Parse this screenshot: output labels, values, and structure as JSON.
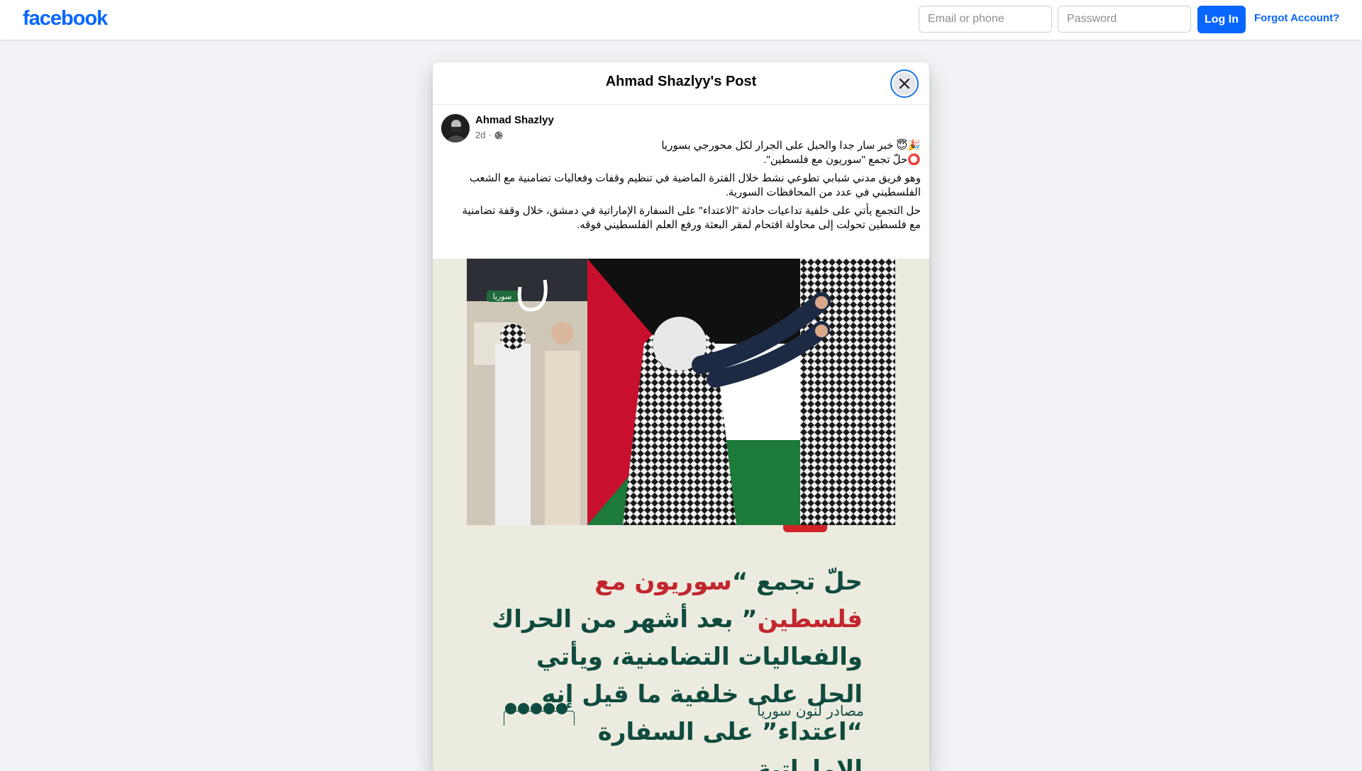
{
  "topbar": {
    "logo": "facebook",
    "email_placeholder": "Email or phone",
    "password_placeholder": "Password",
    "login_label": "Log In",
    "forgot_label": "Forgot Account?"
  },
  "modal": {
    "title": "Ahmad Shazlyy's Post"
  },
  "post": {
    "author": "Ahmad Shazlyy",
    "time": "2d",
    "separator": "·",
    "lines": [
      "🎉😇 خبر سار جدا والحبل على الجرار لكل محورجي بسوريا",
      "⭕حلّ تجمع \"سوريون مع فلسطين\".",
      "وهو فريق مدني شبابي تطوعي نشط خلال الفترة الماضية في تنظيم وقفات وفعاليات تضامنية مع الشعب الفلسطيني في عدد من المحافظات السورية.",
      "حل التجمع يأتي على خلفية تداعيات حادثة \"الاعتداء\" على السفارة الإماراتية في دمشق، خلال وقفة تضامنية مع فلسطين تحولت إلى محاولة اقتحام لمقر البعثة ورفع العلم الفلسطيني فوقه."
    ]
  },
  "image": {
    "badge": "سوريا",
    "headline_part1": "حلّ تجمع “",
    "headline_highlight": "سوريون مع فلسطين",
    "headline_part2": "” بعد أشهر من الحراك والفعاليات التضامنية، ويأتي الحل على خلفية ما قيل إنه “اعتداء” على السفارة الإماراتية",
    "sources": "مصادر لنون سوريا",
    "colors": {
      "headline": "#0f4b3e",
      "highlight": "#c1272d",
      "card_bg": "#ecebe0"
    }
  },
  "icons": {
    "close": "close-icon",
    "globe": "globe-icon",
    "social": [
      "facebook-icon",
      "x-icon",
      "instagram-icon",
      "youtube-icon",
      "tiktok-icon"
    ]
  },
  "colors": {
    "brand": "#0866ff",
    "page_bg": "#f0f2f5"
  }
}
